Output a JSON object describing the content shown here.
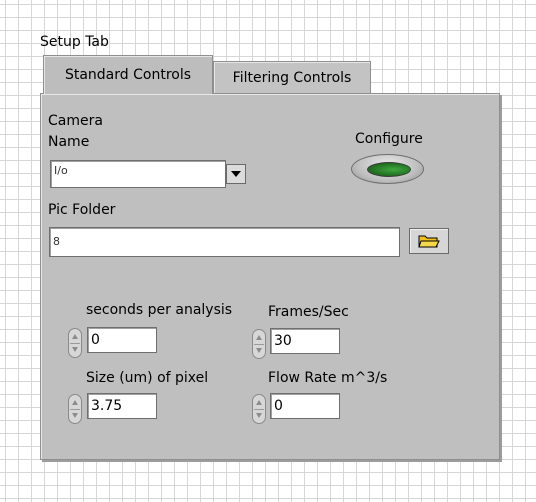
{
  "tab_control": {
    "label": "Setup Tab",
    "tabs": [
      {
        "label": "Standard Controls",
        "active": true
      },
      {
        "label": "Filtering Controls",
        "active": false
      }
    ]
  },
  "camera": {
    "label_line1": "Camera",
    "label_line2": "Name",
    "value": "",
    "prefix": "I/o"
  },
  "configure": {
    "label": "Configure",
    "led_color": "#2f8f2f"
  },
  "pic_folder": {
    "label": "Pic Folder",
    "value": "",
    "prefix": "8"
  },
  "numerics": {
    "seconds_per_analysis": {
      "label": "seconds per analysis",
      "value": "0"
    },
    "frames_per_sec": {
      "label": "Frames/Sec",
      "value": "30"
    },
    "pixel_size": {
      "label": "Size (um) of pixel",
      "value": "3.75"
    },
    "flow_rate": {
      "label": "Flow Rate m^3/s",
      "value": "0"
    }
  },
  "colors": {
    "panel": "#bfbfbf",
    "grid": "#d6d6d6",
    "folder_icon": "#f2c21a"
  },
  "icons": {
    "dropdown": "down-arrow-icon",
    "browse": "folder-icon"
  }
}
